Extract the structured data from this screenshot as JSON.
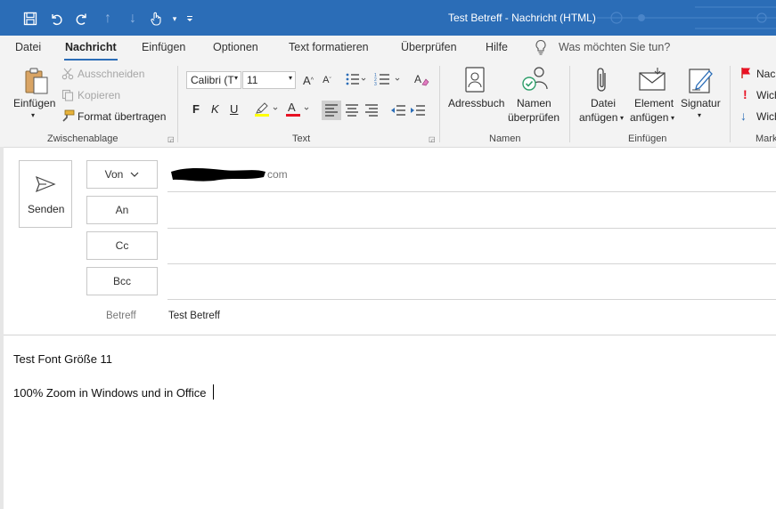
{
  "window": {
    "title": "Test Betreff  -  Nachricht (HTML)"
  },
  "quick_access": {
    "save": "save-icon",
    "undo": "undo-icon",
    "redo": "redo-icon",
    "up": "arrow-up-icon",
    "down": "arrow-down-icon",
    "touch": "touch-mode-icon",
    "more": "customize-icon"
  },
  "tabs": [
    {
      "label": "Datei"
    },
    {
      "label": "Nachricht"
    },
    {
      "label": "Einfügen"
    },
    {
      "label": "Optionen"
    },
    {
      "label": "Text formatieren"
    },
    {
      "label": "Überprüfen"
    },
    {
      "label": "Hilfe"
    }
  ],
  "tell_me": "Was möchten Sie tun?",
  "ribbon": {
    "clipboard": {
      "paste": "Einfügen",
      "cut": "Ausschneiden",
      "copy": "Kopieren",
      "format_painter": "Format übertragen",
      "group": "Zwischenablage"
    },
    "text": {
      "font": "Calibri (T",
      "size": "11",
      "bold": "F",
      "italic": "K",
      "underline": "U",
      "group": "Text"
    },
    "names": {
      "address_book": "Adressbuch",
      "check_names_1": "Namen",
      "check_names_2": "überprüfen",
      "group": "Namen"
    },
    "include": {
      "attach_file_1": "Datei",
      "attach_file_2": "anfügen",
      "attach_item_1": "Element",
      "attach_item_2": "anfügen",
      "signature": "Signatur",
      "group": "Einfügen"
    },
    "tags": {
      "item1": "Nac",
      "item2": "Wich",
      "item3": "Wich",
      "group": "Mark"
    }
  },
  "compose": {
    "send": "Senden",
    "from_label": "Von",
    "from_value": "com",
    "to_label": "An",
    "cc_label": "Cc",
    "bcc_label": "Bcc",
    "subject_label": "Betreff",
    "subject_value": "Test Betreff"
  },
  "body": {
    "line1": "Test Font Größe 11",
    "line2": "100% Zoom in Windows und in Office"
  },
  "colors": {
    "accent": "#2b6db7",
    "highlight": "#ffff00",
    "font_color": "#e81123"
  }
}
